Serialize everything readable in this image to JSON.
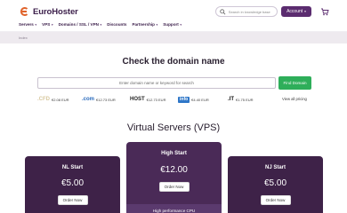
{
  "header": {
    "logo_text": "EuroHoster",
    "search_placeholder": "Search in knowledge base",
    "account_label": "Account",
    "nav": [
      {
        "label": "Servers"
      },
      {
        "label": "VPS"
      },
      {
        "label": "Domains / SSL / VPN"
      },
      {
        "label": "Discounts"
      },
      {
        "label": "Partnership"
      },
      {
        "label": "Support"
      }
    ]
  },
  "breadcrumb": {
    "current": "Index"
  },
  "domain": {
    "title": "Check the domain name",
    "input_placeholder": "Enter domain name or keyword for search",
    "find_label": "Find Domain",
    "view_all": "View all pricing",
    "tlds": [
      {
        "logo": ".CFD",
        "price": "€2.08 EUR",
        "color": "#d8c9a0"
      },
      {
        "logo": ".com",
        "price": "€12.73 EUR",
        "color": "#2a6bbd"
      },
      {
        "logo": "HOST",
        "price": "€12.73 EUR",
        "color": "#222222"
      },
      {
        "logo": "info",
        "price": "€4.40 EUR",
        "color": "#2f77c8"
      },
      {
        "logo": ".IT",
        "price": "€1.75 EUR",
        "color": "#111111"
      }
    ]
  },
  "vps": {
    "title": "Virtual Servers (VPS)",
    "cards": [
      {
        "name": "NL Start",
        "price": "€5.00",
        "order": "Order Now"
      },
      {
        "name": "High Start",
        "price": "€12.00",
        "order": "Order Now",
        "feature": "High performance CPU"
      },
      {
        "name": "NJ Start",
        "price": "€5.00",
        "order": "Order Now"
      }
    ]
  },
  "colors": {
    "brand": "#5b2c6f",
    "card": "#3e2248",
    "accent_green": "#2eae5a"
  }
}
